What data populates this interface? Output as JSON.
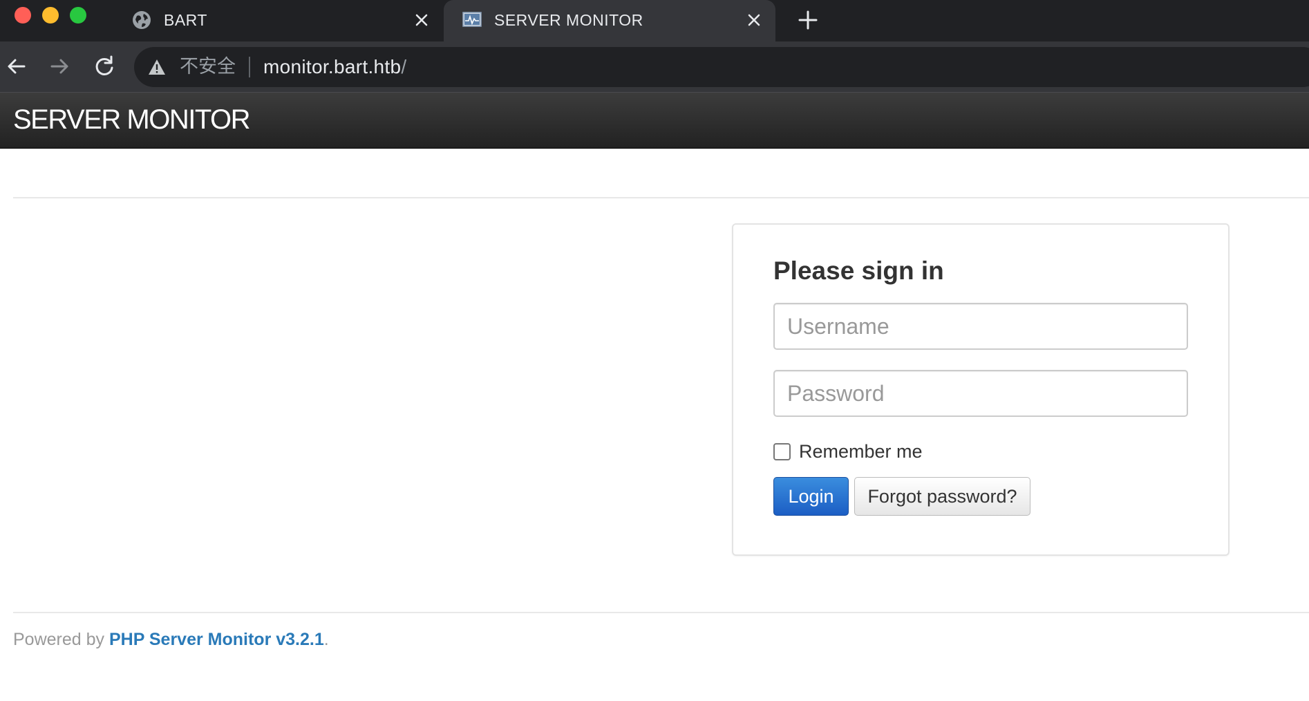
{
  "browser": {
    "tabs": [
      {
        "title": "BART",
        "active": false,
        "favicon": "globe-icon"
      },
      {
        "title": "SERVER MONITOR",
        "active": true,
        "favicon": "monitor-favicon"
      }
    ],
    "address": {
      "security_label": "不安全",
      "host": "monitor.bart.htb",
      "path": "/"
    }
  },
  "page": {
    "brand": "SERVER MONITOR",
    "login": {
      "heading": "Please sign in",
      "username_placeholder": "Username",
      "password_placeholder": "Password",
      "remember_label": "Remember me",
      "login_label": "Login",
      "forgot_label": "Forgot password?"
    },
    "footer": {
      "prefix": "Powered by ",
      "link_text": "PHP Server Monitor v3.2.1",
      "suffix": "."
    }
  },
  "colors": {
    "chrome_bg": "#202124",
    "toolbar_bg": "#35363a",
    "navbar_bg": "#222222",
    "primary_button": "#1c5ec4",
    "footer_link": "#2a7ab8"
  }
}
